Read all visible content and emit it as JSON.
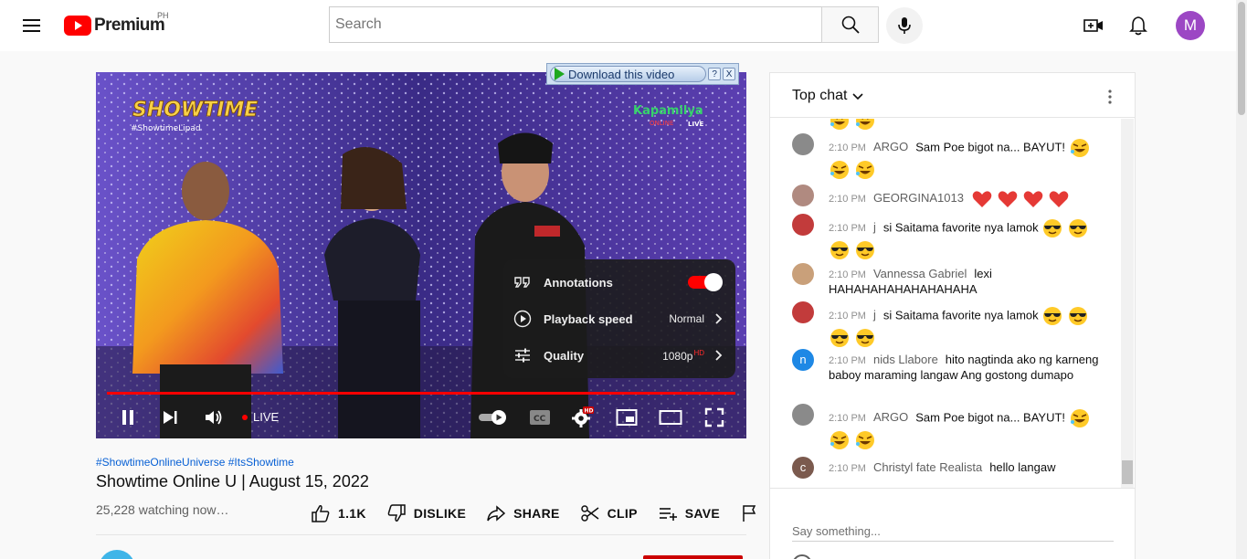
{
  "header": {
    "logo_text": "Premium",
    "country_code": "PH",
    "search_placeholder": "Search",
    "avatar_letter": "M"
  },
  "player": {
    "download_bar": {
      "label": "Download this video",
      "help": "?",
      "close": "X"
    },
    "overlay": {
      "show_logo": "SHOWTIME",
      "show_tag": "#ShowtimeLipad",
      "network_logo": "Kapamilya",
      "network_sub": "ONLINE",
      "network_live": "LIVE"
    },
    "settings_menu": {
      "annotations": {
        "label": "Annotations",
        "on": true
      },
      "playback_speed": {
        "label": "Playback speed",
        "value": "Normal"
      },
      "quality": {
        "label": "Quality",
        "value": "1080p",
        "badge": "HD"
      }
    },
    "live_label": "LIVE",
    "cc_label": "CC",
    "hd_badge": "HD"
  },
  "video": {
    "hashtags": [
      "#ShowtimeOnlineUniverse",
      "#ItsShowtime"
    ],
    "title": "Showtime Online U | August 15, 2022",
    "watching": "25,228 watching now…",
    "actions": {
      "like": "1.1K",
      "dislike": "DISLIKE",
      "share": "SHARE",
      "clip": "CLIP",
      "save": "SAVE"
    }
  },
  "chat": {
    "title": "Top chat",
    "input_placeholder": "Say something...",
    "messages": [
      {
        "time": "2:10 PM",
        "author": "ARGO",
        "text": "Sam Poe bigot na... BAYUT!",
        "avatar_color": "#8a8a8a",
        "emoji": "rofl"
      },
      {
        "time": "2:10 PM",
        "author": "GEORGINA1013",
        "text": "",
        "avatar_color": "#b08a80",
        "emoji": "heart"
      },
      {
        "time": "2:10 PM",
        "author": "j",
        "text": "si Saitama favorite nya lamok",
        "avatar_color": "#c23b3b",
        "emoji": "cool"
      },
      {
        "time": "2:10 PM",
        "author": "Vannessa Gabriel",
        "text": "lexi HAHAHAHAHAHAHAHAHA",
        "avatar_color": "#c9a07a",
        "emoji": ""
      },
      {
        "time": "2:10 PM",
        "author": "j",
        "text": "si Saitama favorite nya lamok",
        "avatar_color": "#c23b3b",
        "emoji": "cool"
      },
      {
        "time": "2:10 PM",
        "author": "nids Llabore",
        "text": "hito nagtinda ako ng karneng baboy maraming langaw Ang gostong dumapo",
        "avatar_color": "#1e88e5",
        "avatar_letter": "n",
        "emoji": ""
      },
      {
        "time": "2:10 PM",
        "author": "ARGO",
        "text": "Sam Poe bigot na... BAYUT!",
        "avatar_color": "#8a8a8a",
        "emoji": "rofl"
      },
      {
        "time": "2:10 PM",
        "author": "Christyl fate Realista",
        "text": "hello langaw",
        "avatar_color": "#7b5a4e",
        "avatar_letter": "c",
        "emoji": ""
      }
    ]
  }
}
